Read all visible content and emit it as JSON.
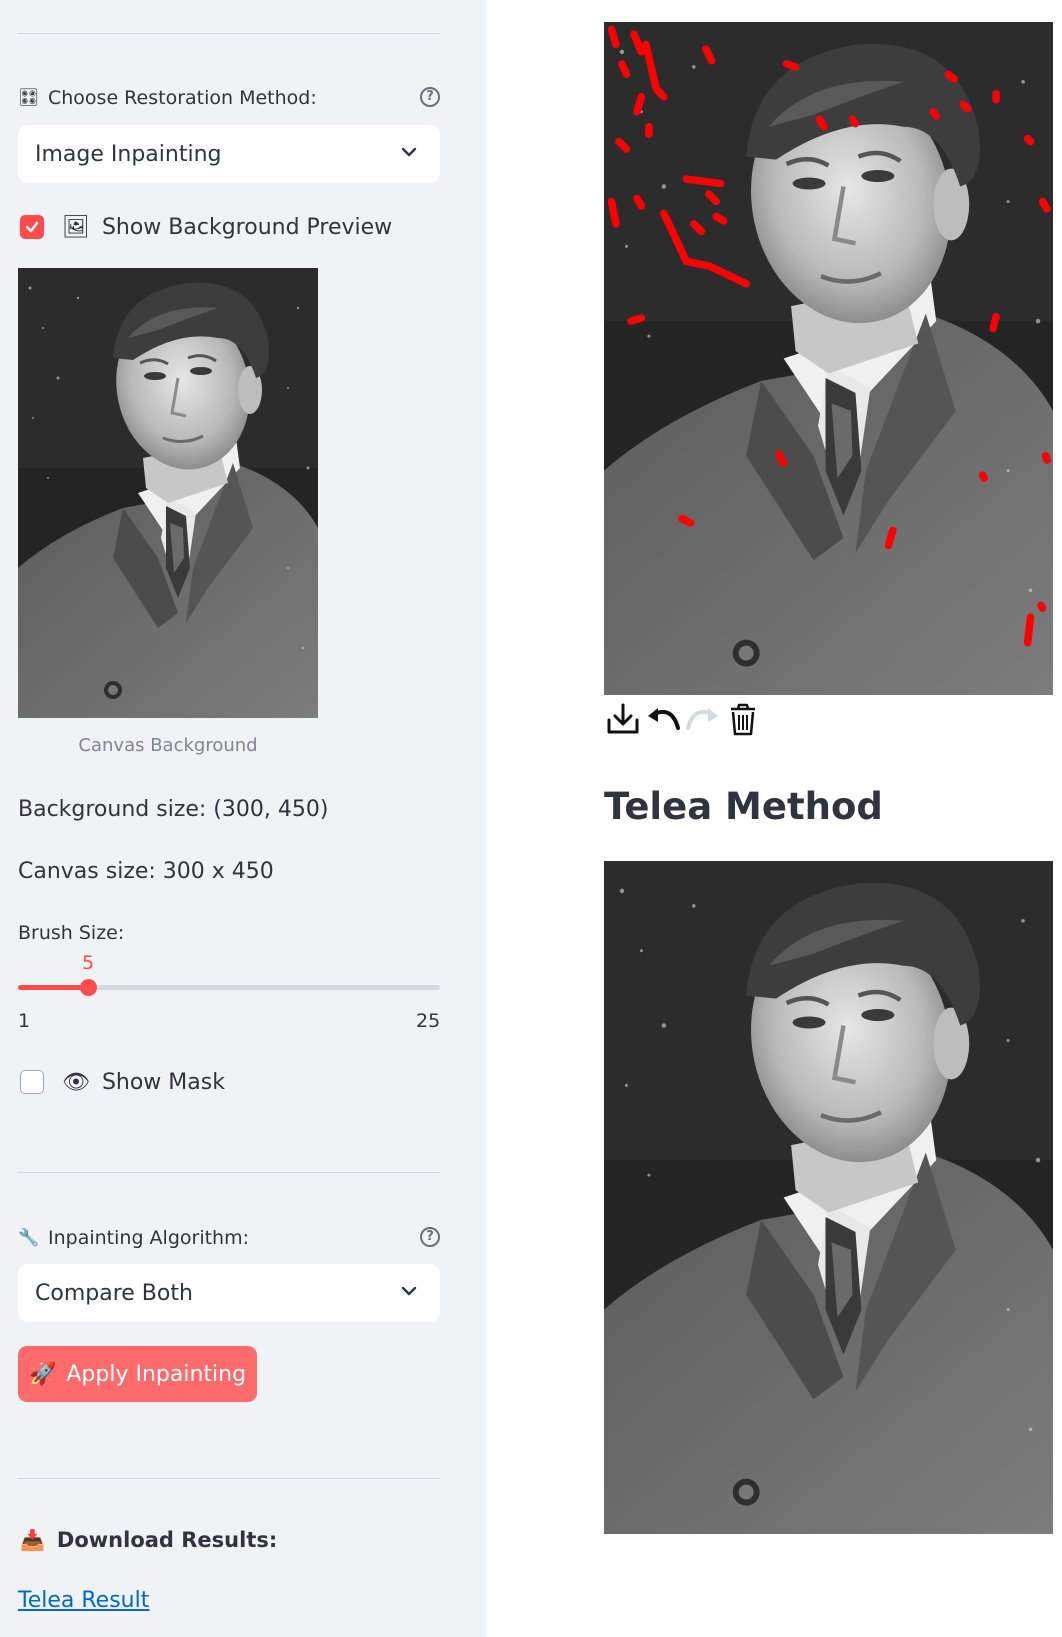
{
  "sidebar": {
    "restoration": {
      "icon": "control-knobs-icon",
      "label": "Choose Restoration Method:",
      "selected": "Image Inpainting"
    },
    "show_background_preview": {
      "checked": true,
      "icon": "framed-picture-icon",
      "label": "Show Background Preview"
    },
    "preview_caption": "Canvas Background",
    "background_size": "Background size: (300, 450)",
    "canvas_size": "Canvas size: 300 x 450",
    "brush": {
      "label": "Brush Size:",
      "value": "5",
      "min": "1",
      "max": "25",
      "fraction": 0.1667
    },
    "show_mask": {
      "checked": false,
      "icon": "eye-icon",
      "label": "Show Mask"
    },
    "algorithm": {
      "icon": "wrench-icon",
      "label": "Inpainting Algorithm:",
      "selected": "Compare Both"
    },
    "apply_button": {
      "icon": "rocket-icon",
      "label": "Apply Inpainting"
    },
    "download": {
      "icon": "inbox-tray-icon",
      "label": "Download Results:",
      "link": "Telea Result"
    }
  },
  "main": {
    "toolbar": [
      "download-icon",
      "undo-icon",
      "redo-icon",
      "trash-icon"
    ],
    "result_title": "Telea Method"
  },
  "colors": {
    "accent": "#ff4b4b",
    "button": "#ff6b6b",
    "sidebar_bg": "#f0f2f6",
    "mask_stroke": "#ff0000",
    "link": "#0068c9"
  }
}
